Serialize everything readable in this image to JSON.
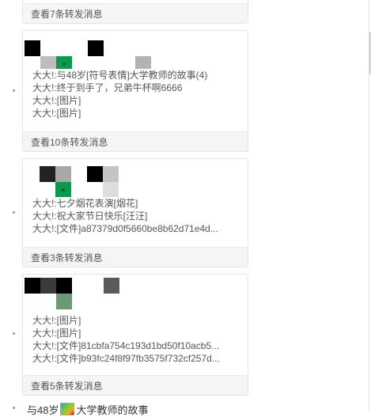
{
  "cards": [
    {
      "footer": "查看7条转发消息",
      "lines": []
    },
    {
      "footer": "查看10条转发消息",
      "lines": [
        "大大!:与48岁[符号表情]大学教师的故事(4)",
        "大大!:终于到手了，兄弟牛杯啊6666",
        "大大!:[图片]",
        "大大!:[图片]"
      ]
    },
    {
      "footer": "查看3条转发消息",
      "lines": [
        "大大!:七夕烟花表演[烟花]",
        "大大!:祝大家节日快乐[汪汪]",
        "大大!:[文件]a87379d0f5660be8b62d71e4d..."
      ]
    },
    {
      "footer": "查看5条转发消息",
      "lines": [
        "大大!:[图片]",
        "大大!:[图片]",
        "大大!:[文件]81cbfa754c193d1bd50f10acb5...",
        "大大!:[文件]b93fc24f8f97fb3575f732cf257d..."
      ]
    }
  ],
  "bottom": {
    "before": "与48岁",
    "after": "大学教师的故事"
  },
  "colors": {
    "footer_bg": "#f3f5f7",
    "card_border": "#e1e4e8",
    "avatar_green": "#0a9a4a"
  }
}
